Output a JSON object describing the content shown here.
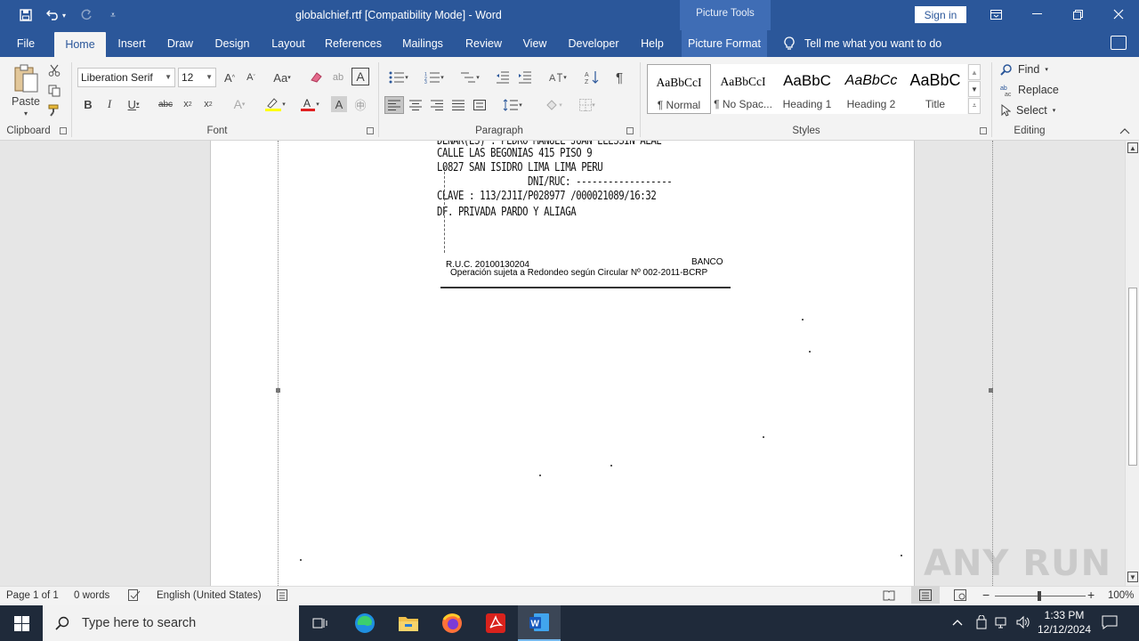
{
  "app": {
    "title": "globalchief.rtf [Compatibility Mode]  -  Word",
    "picture_tools": "Picture Tools",
    "sign_in": "Sign in"
  },
  "tabs": [
    "File",
    "Home",
    "Insert",
    "Draw",
    "Design",
    "Layout",
    "References",
    "Mailings",
    "Review",
    "View",
    "Developer",
    "Help",
    "Picture Format"
  ],
  "active_tab": "Home",
  "tell_me": "Tell me what you want to do",
  "ribbon": {
    "clipboard": {
      "label": "Clipboard",
      "paste": "Paste"
    },
    "font": {
      "label": "Font",
      "font_name": "Liberation Serif",
      "font_size": "12"
    },
    "paragraph": {
      "label": "Paragraph"
    },
    "styles": {
      "label": "Styles",
      "items": [
        {
          "sample": "AaBbCcI",
          "name": "¶ Normal"
        },
        {
          "sample": "AaBbCcI",
          "name": "¶ No Spac..."
        },
        {
          "sample": "AaBbC",
          "name": "Heading 1"
        },
        {
          "sample": "AaBbCc",
          "name": "Heading 2"
        },
        {
          "sample": "AaBbC",
          "name": "Title"
        }
      ]
    },
    "editing": {
      "label": "Editing",
      "find": "Find",
      "replace": "Replace",
      "select": "Select"
    }
  },
  "document": {
    "receipt_lines": [
      "DENAR(ES) : PEDRO MANUEL JUAN ELESSIN ALAE",
      "CALLE LAS BEGONIAS 415 PISO 9",
      "L0827 SAN ISIDRO LIMA LIMA PERU",
      "DNI/RUC: ------------------",
      "CLAVE : 113/2J1I/P028977 /000021089/16:32",
      "DF. PRIVADA PARDO Y ALIAGA"
    ],
    "ruc": "R.U.C. 20100130204",
    "banco": "BANCO",
    "operacion": "Operación sujeta a Redondeo según Circular Nº 002-2011-BCRP"
  },
  "status": {
    "page": "Page 1 of 1",
    "words": "0 words",
    "language": "English (United States)",
    "zoom": "100%"
  },
  "taskbar": {
    "search_placeholder": "Type here to search",
    "time": "1:33 PM",
    "date": "12/12/2024"
  },
  "watermark": "ANY RUN"
}
